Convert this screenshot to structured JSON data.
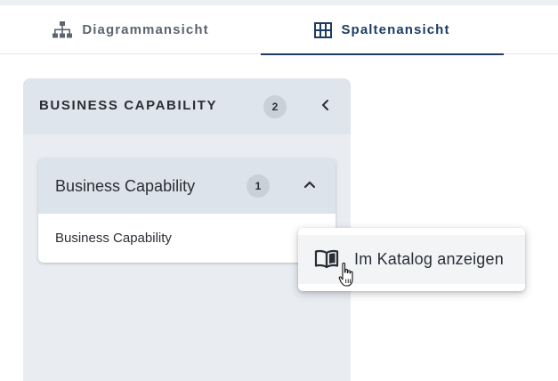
{
  "tabs": [
    {
      "label": "Diagrammansicht",
      "icon": "sitemap-icon",
      "active": false
    },
    {
      "label": "Spaltenansicht",
      "icon": "columns-grid-icon",
      "active": true
    }
  ],
  "column": {
    "title": "BUSINESS CAPABILITY",
    "count": "2",
    "collapse_icon": "chevron-left-icon"
  },
  "group": {
    "title": "Business Capability",
    "count": "1",
    "toggle_icon": "chevron-up-icon",
    "items": [
      {
        "label": "Business Capability"
      }
    ]
  },
  "context_menu": {
    "items": [
      {
        "label": "Im Katalog anzeigen",
        "icon": "open-book-icon"
      }
    ]
  },
  "colors": {
    "accent": "#1d3c63",
    "column_bg": "#e9edf2",
    "badge_bg": "#c9d0d9"
  }
}
